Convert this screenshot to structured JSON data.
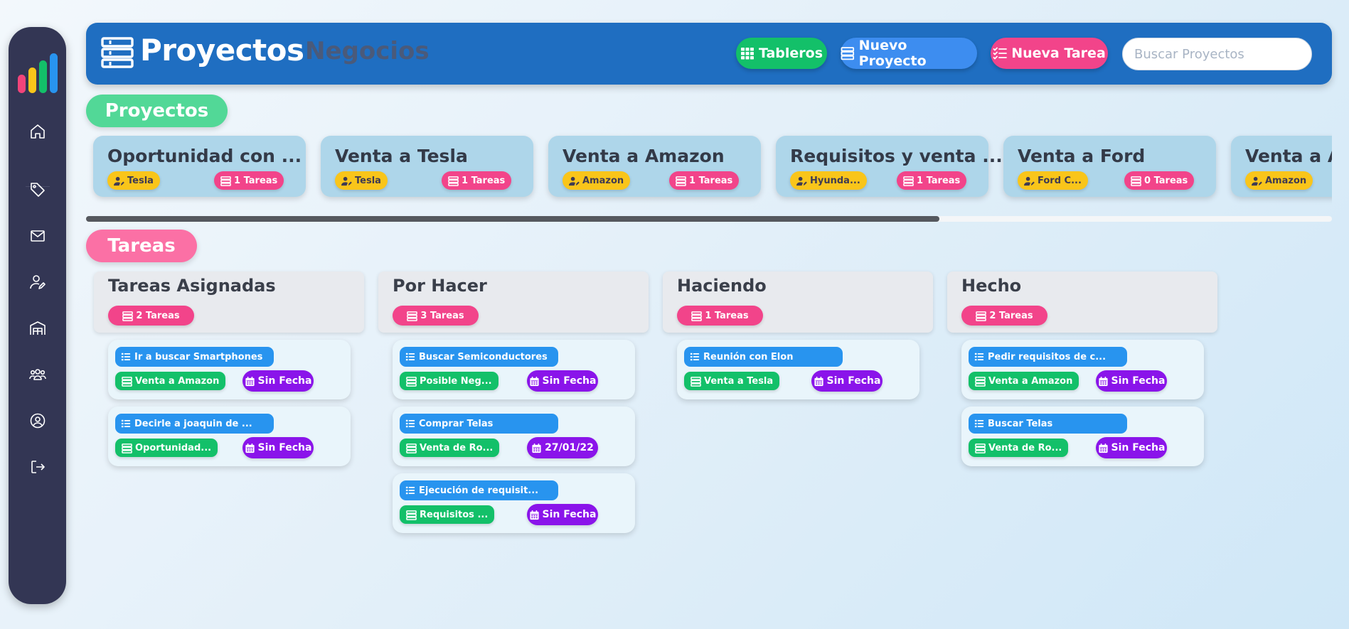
{
  "sidebar": {
    "icons": [
      "home-icon",
      "tag-icon",
      "mail-icon",
      "user-edit-icon",
      "warehouse-icon",
      "users-icon",
      "user-circle-icon",
      "logout-icon"
    ]
  },
  "header": {
    "title": "Proyectos",
    "subtitle": "Negocios",
    "buttons": {
      "tableros": "Tableros",
      "nuevo_proyecto": "Nuevo Proyecto",
      "nueva_tarea": "Nueva Tarea"
    },
    "search_placeholder": "Buscar Proyectos"
  },
  "colors": {
    "header": "#1f6ec1",
    "sidebar": "#333654",
    "green": "#13c069",
    "blue": "#2894ef",
    "pink": "#f2448a",
    "purple": "#8a14ea",
    "yellow": "#f9c51a"
  },
  "sections": {
    "proyectos": "Proyectos",
    "tareas": "Tareas"
  },
  "projects": [
    {
      "title": "Oportunidad con ...",
      "company": "Tesla",
      "tasks": "1 Tareas"
    },
    {
      "title": "Venta a Tesla",
      "company": "Tesla",
      "tasks": "1 Tareas"
    },
    {
      "title": "Venta a Amazon",
      "company": "Amazon",
      "tasks": "1 Tareas"
    },
    {
      "title": "Requisitos y venta ...",
      "company": "Hyunda...",
      "tasks": "1 Tareas"
    },
    {
      "title": "Venta a Ford",
      "company": "Ford C...",
      "tasks": "0 Tareas"
    },
    {
      "title": "Venta a Amazon",
      "company": "Amazon",
      "tasks": ""
    }
  ],
  "columns": [
    {
      "title": "Tareas Asignadas",
      "count": "2 Tareas",
      "tasks": [
        {
          "name": "Ir a buscar Smartphones",
          "project": "Venta a Amazon",
          "date": "Sin Fecha"
        },
        {
          "name": "Decirle a joaquin de ...",
          "project": "Oportunidad...",
          "date": "Sin Fecha"
        }
      ]
    },
    {
      "title": "Por Hacer",
      "count": "3 Tareas",
      "tasks": [
        {
          "name": "Buscar Semiconductores",
          "project": "Posible Neg...",
          "date": "Sin Fecha"
        },
        {
          "name": "Comprar Telas",
          "project": "Venta de Ro...",
          "date": "27/01/22"
        },
        {
          "name": "Ejecución de requisit...",
          "project": "Requisitos ...",
          "date": "Sin Fecha"
        }
      ]
    },
    {
      "title": "Haciendo",
      "count": "1 Tareas",
      "tasks": [
        {
          "name": "Reunión con Elon",
          "project": "Venta a Tesla",
          "date": "Sin Fecha"
        }
      ]
    },
    {
      "title": "Hecho",
      "count": "2 Tareas",
      "tasks": [
        {
          "name": "Pedir requisitos de c...",
          "project": "Venta a Amazon",
          "date": "Sin Fecha"
        },
        {
          "name": "Buscar Telas",
          "project": "Venta de Ro...",
          "date": "Sin Fecha"
        }
      ]
    }
  ]
}
